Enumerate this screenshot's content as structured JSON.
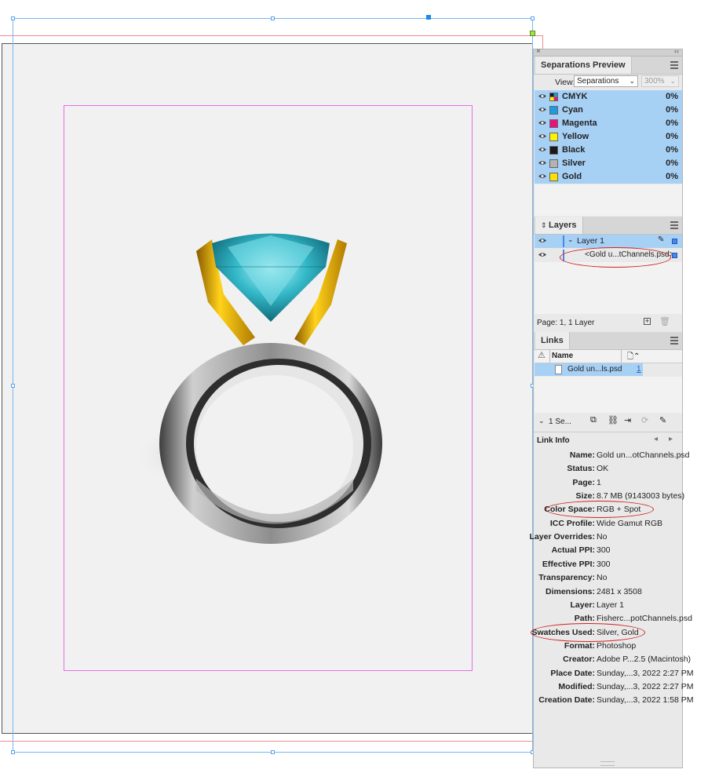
{
  "separations": {
    "tab": "Separations Preview",
    "view_label": "View:",
    "view_value": "Separations",
    "zoom_value": "300%",
    "rows": [
      {
        "name": "CMYK",
        "pct": "0%",
        "color": "#cmyk"
      },
      {
        "name": "Cyan",
        "pct": "0%",
        "color": "#1a9de0"
      },
      {
        "name": "Magenta",
        "pct": "0%",
        "color": "#e8127f"
      },
      {
        "name": "Yellow",
        "pct": "0%",
        "color": "#fff200"
      },
      {
        "name": "Black",
        "pct": "0%",
        "color": "#1a1a1a"
      },
      {
        "name": "Silver",
        "pct": "0%",
        "color": "#b3b3b3"
      },
      {
        "name": "Gold",
        "pct": "0%",
        "color": "#ffe100"
      }
    ]
  },
  "layers": {
    "tab": "Layers",
    "layer_name": "Layer 1",
    "item_name": "<Gold u...tChannels.psd>",
    "footer": "Page: 1, 1 Layer"
  },
  "links": {
    "tab": "Links",
    "col_name": "Name",
    "file_name": "Gold un...ls.psd",
    "file_page": "1",
    "selection": "1 Se..."
  },
  "link_info": {
    "title": "Link Info",
    "rows": [
      {
        "label": "Name:",
        "value": "Gold un...otChannels.psd"
      },
      {
        "label": "Status:",
        "value": "OK"
      },
      {
        "label": "Page:",
        "value": "1"
      },
      {
        "label": "Size:",
        "value": "8.7 MB (9143003 bytes)"
      },
      {
        "label": "Color Space:",
        "value": "RGB + Spot"
      },
      {
        "label": "ICC Profile:",
        "value": "Wide Gamut RGB"
      },
      {
        "label": "Layer Overrides:",
        "value": "No"
      },
      {
        "label": "Actual PPI:",
        "value": "300"
      },
      {
        "label": "Effective PPI:",
        "value": "300"
      },
      {
        "label": "Transparency:",
        "value": "No"
      },
      {
        "label": "Dimensions:",
        "value": "2481 x 3508"
      },
      {
        "label": "Layer:",
        "value": "Layer 1"
      },
      {
        "label": "Path:",
        "value": "Fisherc...potChannels.psd"
      },
      {
        "label": "Swatches Used:",
        "value": "Silver, Gold"
      },
      {
        "label": "Format:",
        "value": "Photoshop"
      },
      {
        "label": "Creator:",
        "value": "Adobe P...2.5 (Macintosh)"
      },
      {
        "label": "Place Date:",
        "value": "Sunday,...3, 2022 2:27 PM"
      },
      {
        "label": "Modified:",
        "value": "Sunday,...3, 2022 2:27 PM"
      },
      {
        "label": "Creation Date:",
        "value": "Sunday,...3, 2022 1:58 PM"
      }
    ]
  }
}
